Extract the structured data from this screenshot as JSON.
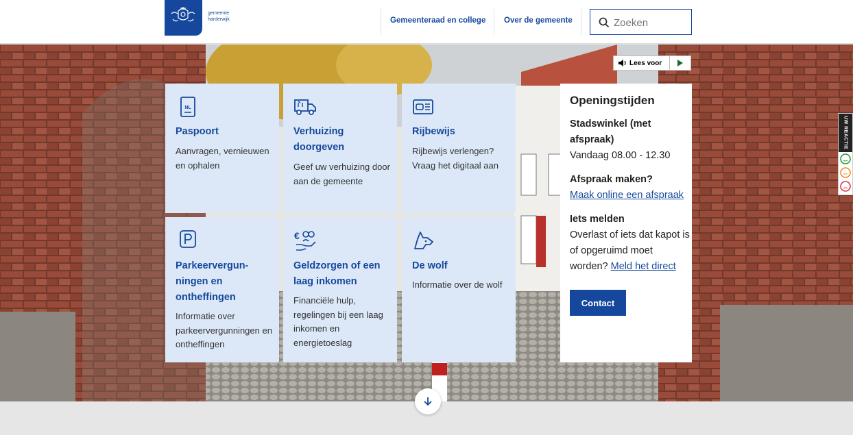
{
  "header": {
    "logo_text_line1": "gemeente",
    "logo_text_line2": "harderwijk",
    "nav": [
      "Gemeenteraad en college",
      "Over de gemeente"
    ],
    "search_placeholder": "Zoeken"
  },
  "read_aloud": {
    "label": "Lees voor"
  },
  "feedback": {
    "label": "UW REACTIE"
  },
  "tiles": [
    {
      "title": "Paspoort",
      "desc": "Aanvragen, vernieuwen en ophalen",
      "icon": "passport-icon"
    },
    {
      "title": "Verhuizing doorgeven",
      "desc": "Geef uw verhuizing door aan de gemeente",
      "icon": "moving-truck-icon"
    },
    {
      "title": "Rijbewijs",
      "desc": "Rijbewijs verlengen? Vraag het digitaal aan",
      "icon": "driving-license-icon"
    },
    {
      "title": "Parkeervergun-ningen en ontheffingen",
      "desc": "Informatie over parkeervergunningen en ontheffingen",
      "icon": "parking-icon"
    },
    {
      "title": "Geldzorgen of een laag inkomen",
      "desc": "Financiële hulp, regelingen bij een laag inkomen en energietoeslag",
      "icon": "money-worries-icon"
    },
    {
      "title": "De wolf",
      "desc": "Informatie over de wolf",
      "icon": "wolf-icon"
    }
  ],
  "opening": {
    "title": "Openingstijden",
    "stadswinkel_title": "Stadswinkel (met afspraak)",
    "stadswinkel_hours": "Vandaag 08.00 - 12.30",
    "afspraak_title": "Afspraak maken?",
    "afspraak_link": "Maak online een afspraak",
    "melden_title": "Iets melden",
    "melden_text": "Overlast of iets dat kapot is of opgeruimd moet worden?",
    "melden_link": "Meld het direct",
    "contact_button": "Contact"
  },
  "colors": {
    "brand": "#15489c",
    "tile_bg": "#dce8f7"
  }
}
